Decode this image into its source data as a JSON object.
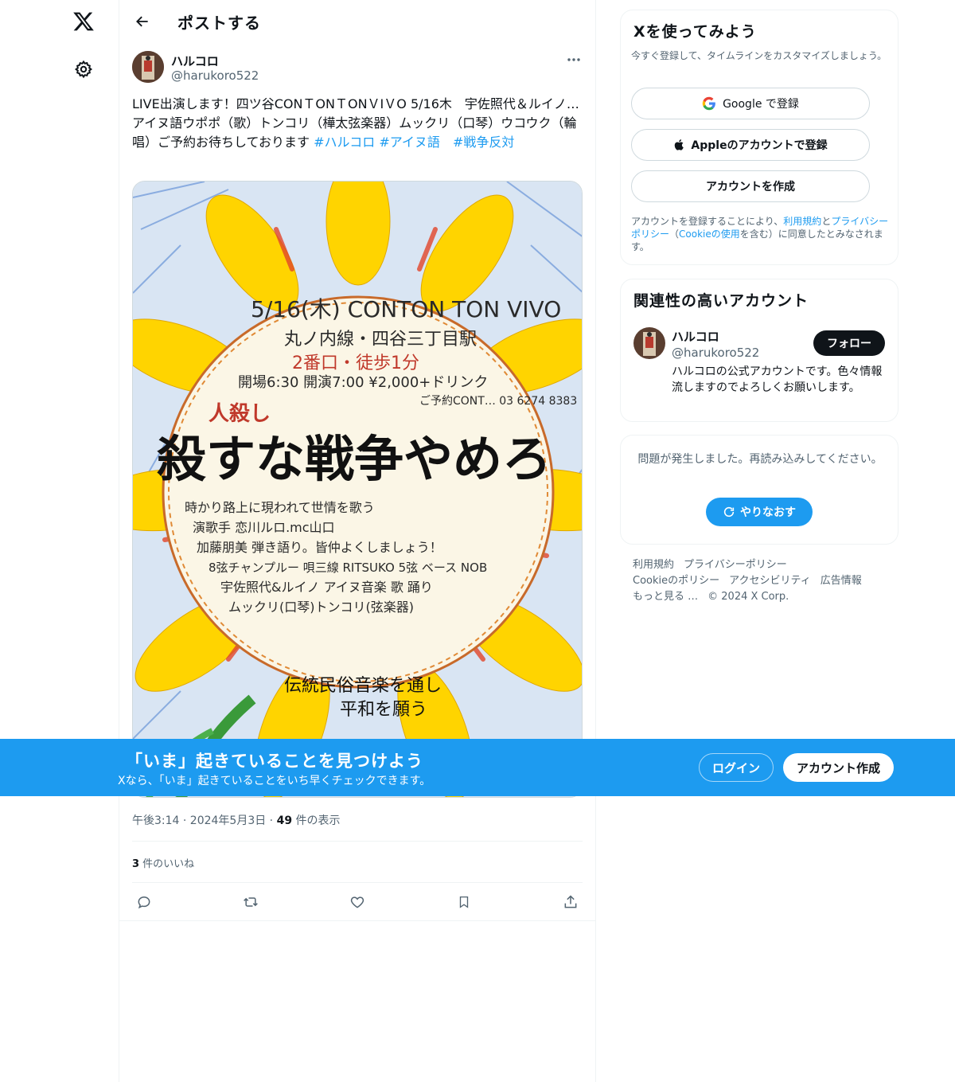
{
  "header": {
    "title": "ポストする"
  },
  "tweet": {
    "author_name": "ハルコロ",
    "author_handle": "@harukoro522",
    "text_main": "LIVE出演します！四ツ谷CONＴONＴONＶIＶO 5/16木　宇佐照代＆ルイノ…アイヌ語ウポポ（歌）トンコリ（樺太弦楽器）ムックリ（口琴）ウコウク（輪唱）ご予約お待ちしております ",
    "hashtags": [
      "#ハルコロ",
      "#アイヌ語",
      "#戦争反対"
    ],
    "timestamp": "午後3:14 · 2024年5月3日 · ",
    "views_count": "49",
    "views_label": " 件の表示",
    "likes_count": "3",
    "likes_label": " 件のいいね"
  },
  "signup_card": {
    "title": "Xを使ってみよう",
    "subtitle": "今すぐ登録して、タイムラインをカスタマイズしましょう。",
    "google_button": "Google で登録",
    "apple_button": "Appleのアカウントで登録",
    "create_button": "アカウントを作成",
    "legal_prefix": "アカウントを登録することにより、",
    "legal_terms": "利用規約",
    "legal_and": "と",
    "legal_privacy": "プライバシーポリシー",
    "legal_open": "（",
    "legal_cookie": "Cookieの使用",
    "legal_suffix": "を含む）に同意したとみなされます。"
  },
  "related_card": {
    "title": "関連性の高いアカウント",
    "name": "ハルコロ",
    "handle": "@harukoro522",
    "bio": "ハルコロの公式アカウントです。色々情報流しますのでよろしくお願いします。",
    "follow_button": "フォロー"
  },
  "error_card": {
    "message": "問題が発生しました。再読み込みしてください。",
    "retry_button": "やりなおす"
  },
  "footer": {
    "links": [
      "利用規約",
      "プライバシーポリシー",
      "Cookieのポリシー",
      "アクセシビリティ",
      "広告情報",
      "もっと見る …"
    ],
    "copyright": "© 2024 X Corp."
  },
  "banner": {
    "title": "「いま」起きていることを見つけよう",
    "subtitle": "Xなら、「いま」起きていることをいち早くチェックできます。",
    "login_button": "ログイン",
    "signup_button": "アカウント作成"
  },
  "poster": {
    "line1": "5/16(木) CONTON TON VIVO",
    "line2": "丸ノ内線・四谷三丁目駅",
    "line3": "2番口・徒歩1分",
    "line4": "開場6:30 開演7:00 ¥2,000+ドリンク",
    "line5": "ご予約CONT… 03 6274 8383",
    "headline_small": "人殺し",
    "headline": "殺すな戦争やめろ",
    "body1": "時かり路上に現われて世情を歌う",
    "body2": "演歌手 恋川ルロ.mc山口",
    "body3": "加藤朋美 弾き語り。皆仲よくしましょう！",
    "body4": "8弦チャンプルー 唄三線 RITSUKO 5弦 ベース NOB",
    "body5": "宇佐照代&ルイノ アイヌ音楽 歌 踊り",
    "body6": "ムックリ(口琴)トンコリ(弦楽器)",
    "body7": "伝統民俗音楽を通し",
    "body8": "平和を願う"
  },
  "colors": {
    "accent": "#1d9bf0",
    "text": "#0f1419",
    "muted": "#536471",
    "border": "#eff3f4"
  }
}
